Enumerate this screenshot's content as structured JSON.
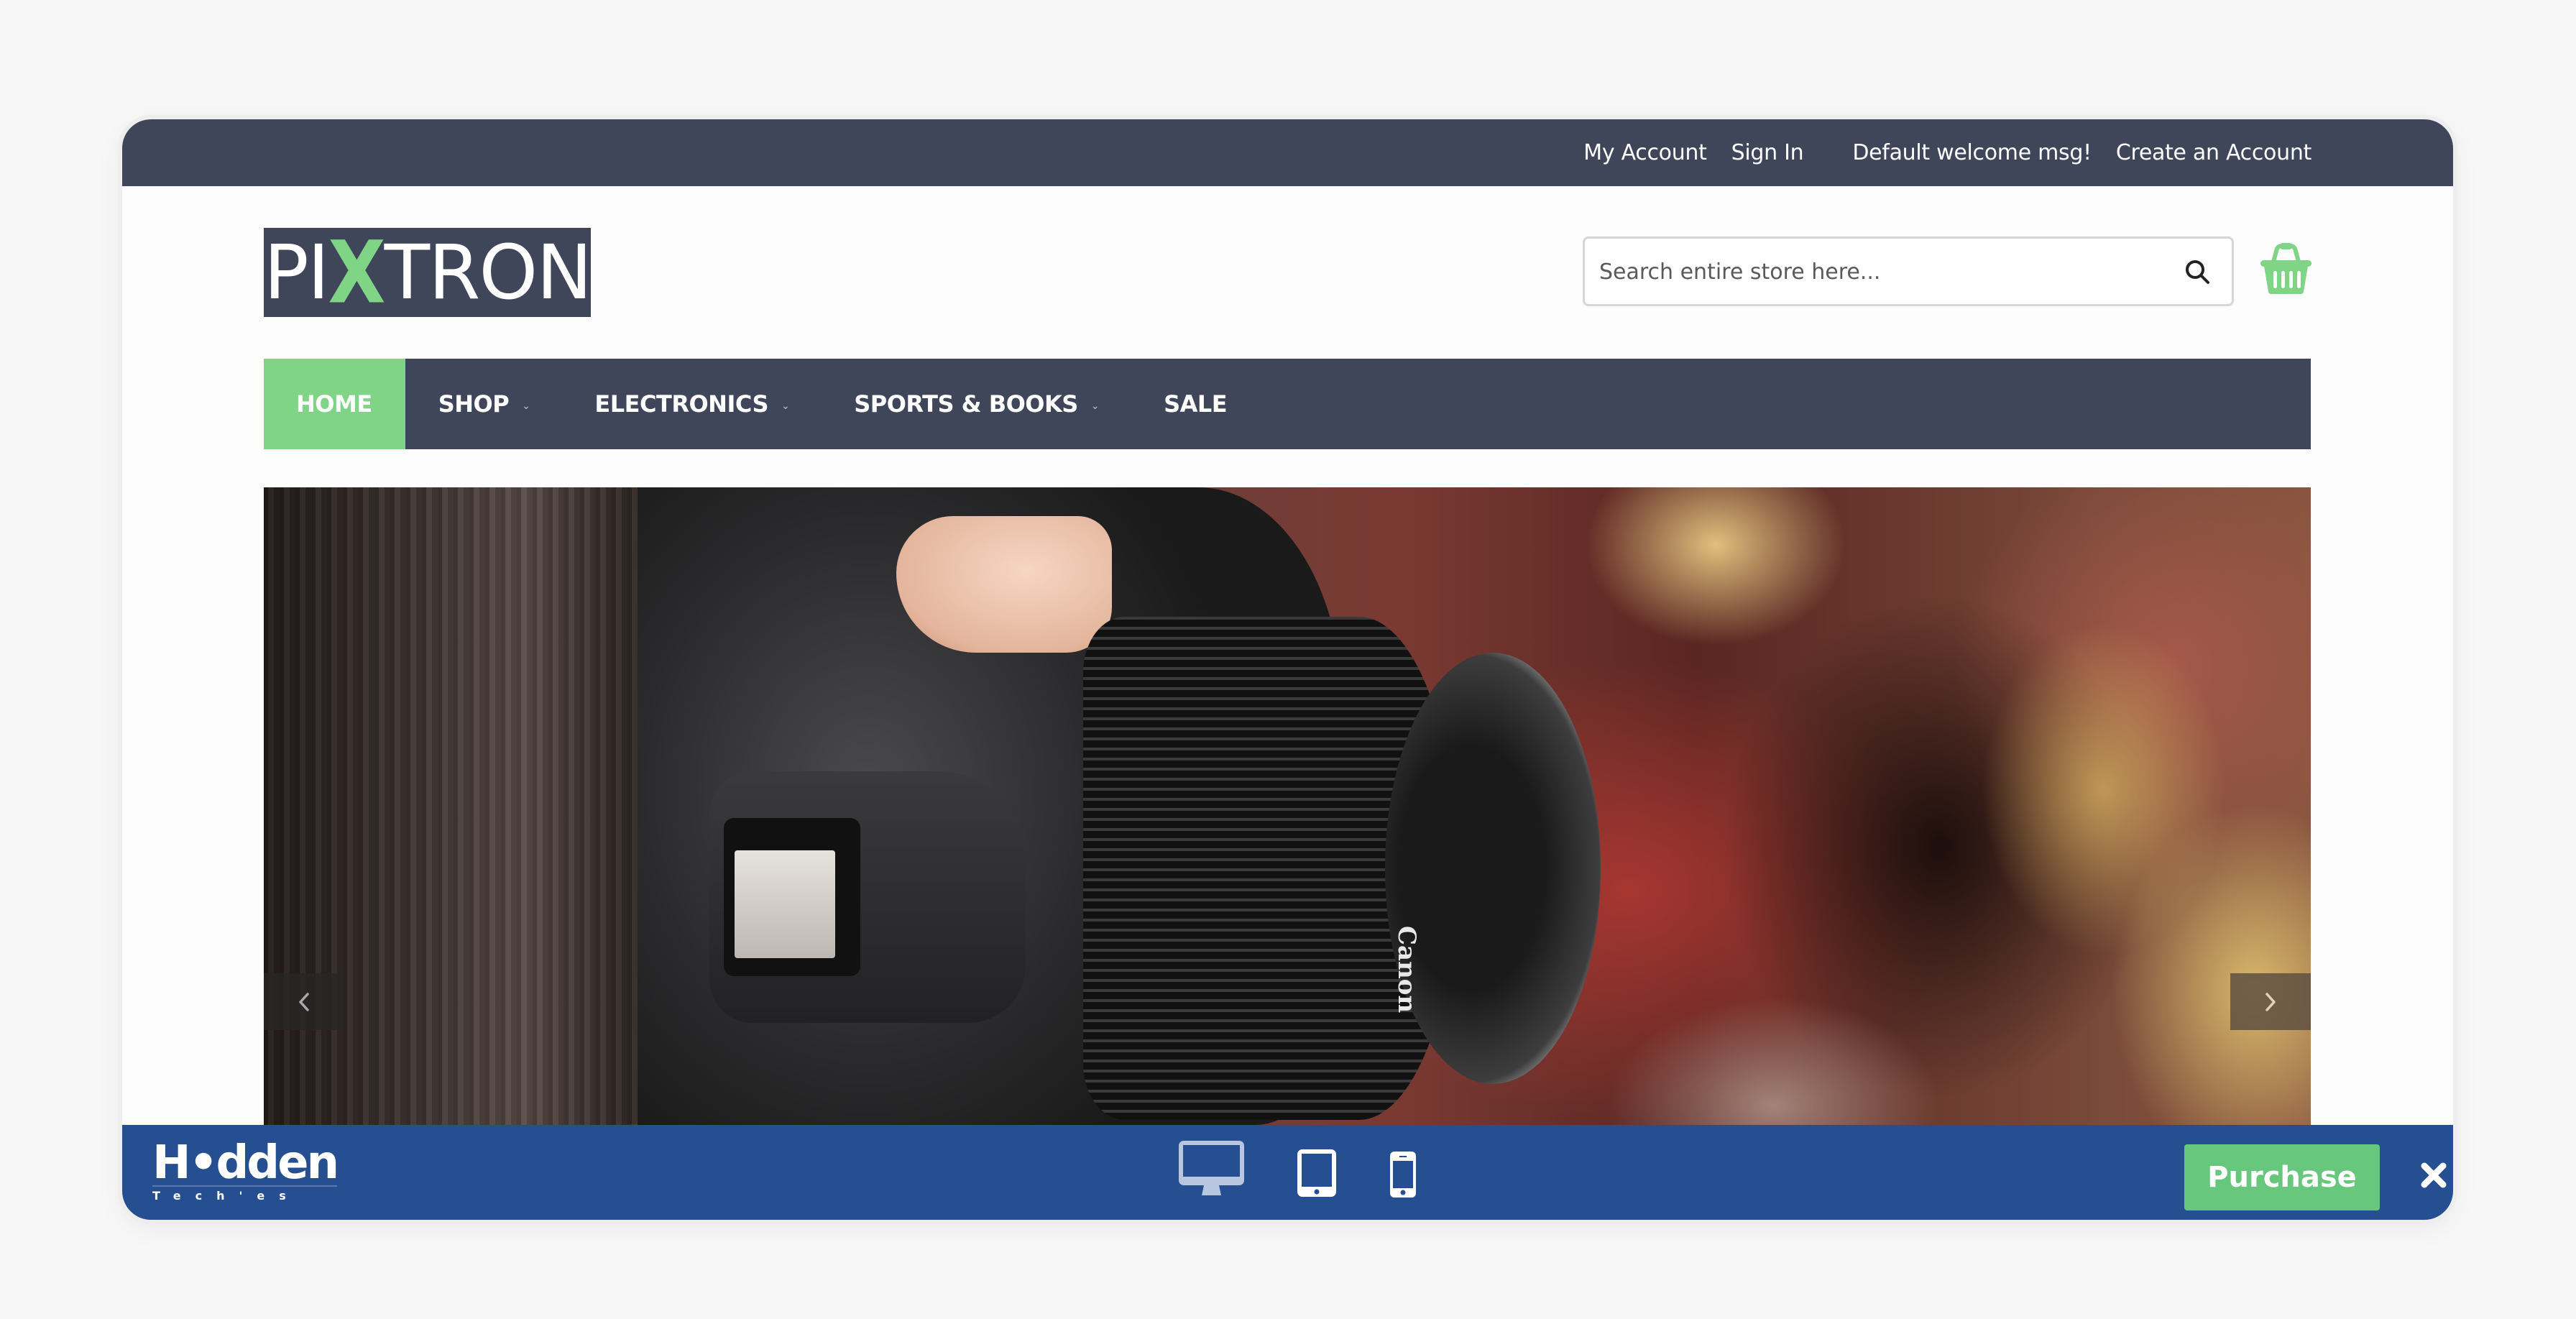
{
  "topbar": {
    "links": [
      "My Account",
      "Sign In"
    ],
    "welcome": "Default welcome msg!",
    "create_account": "Create an Account"
  },
  "logo": {
    "text_before": "PI",
    "text_x": "X",
    "text_after": "TRON",
    "accent_color": "#7fd486"
  },
  "search": {
    "placeholder": "Search entire store here...",
    "value": "",
    "icon": "search-icon"
  },
  "cart": {
    "icon": "basket-icon"
  },
  "nav": {
    "items": [
      {
        "label": "HOME",
        "active": true,
        "has_dropdown": false
      },
      {
        "label": "SHOP",
        "active": false,
        "has_dropdown": true
      },
      {
        "label": "ELECTRONICS",
        "active": false,
        "has_dropdown": true
      },
      {
        "label": "SPORTS & BOOKS",
        "active": false,
        "has_dropdown": true
      },
      {
        "label": "SALE",
        "active": false,
        "has_dropdown": false
      }
    ],
    "dropdown_glyph": "⌄"
  },
  "hero": {
    "image_alt": "Photographer holding a Canon DSLR camera",
    "lens_brand": "Canon",
    "prev_icon": "chevron-left-icon",
    "next_icon": "chevron-right-icon"
  },
  "preview_bar": {
    "brand_main": "H•dden",
    "brand_sub": "Tech'es",
    "devices": [
      {
        "name": "desktop",
        "active": true
      },
      {
        "name": "tablet",
        "active": false
      },
      {
        "name": "mobile",
        "active": false
      }
    ],
    "purchase_label": "Purchase",
    "close_icon": "close-icon"
  },
  "colors": {
    "header_dark": "#40465a",
    "accent_green": "#7fd486",
    "preview_blue": "#264f91",
    "purchase_green": "#67c77c"
  }
}
